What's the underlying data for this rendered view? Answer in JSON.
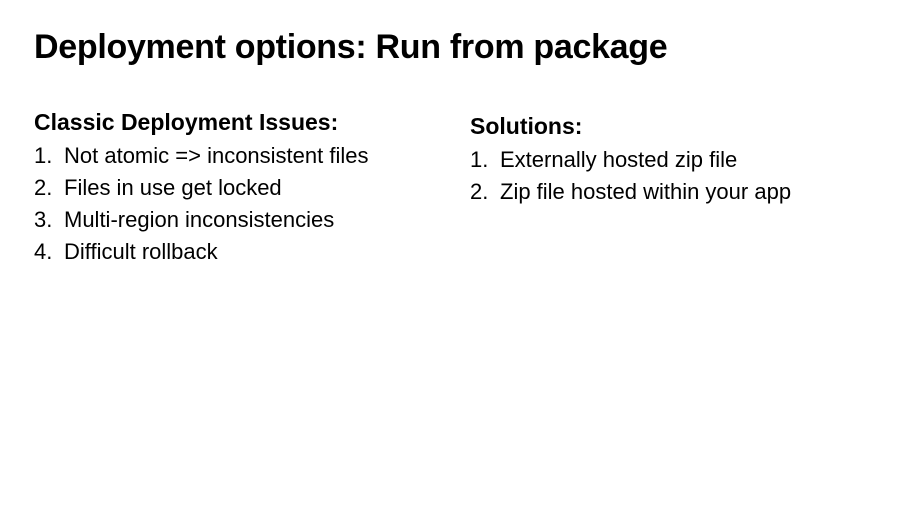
{
  "title": "Deployment options: Run from package",
  "left": {
    "heading": "Classic Deployment Issues:",
    "items": [
      "Not atomic => inconsistent files",
      "Files in use get locked",
      "Multi-region inconsistencies",
      "Difficult rollback"
    ]
  },
  "right": {
    "heading": "Solutions:",
    "items": [
      "Externally hosted zip file",
      "Zip file hosted within your app"
    ]
  }
}
